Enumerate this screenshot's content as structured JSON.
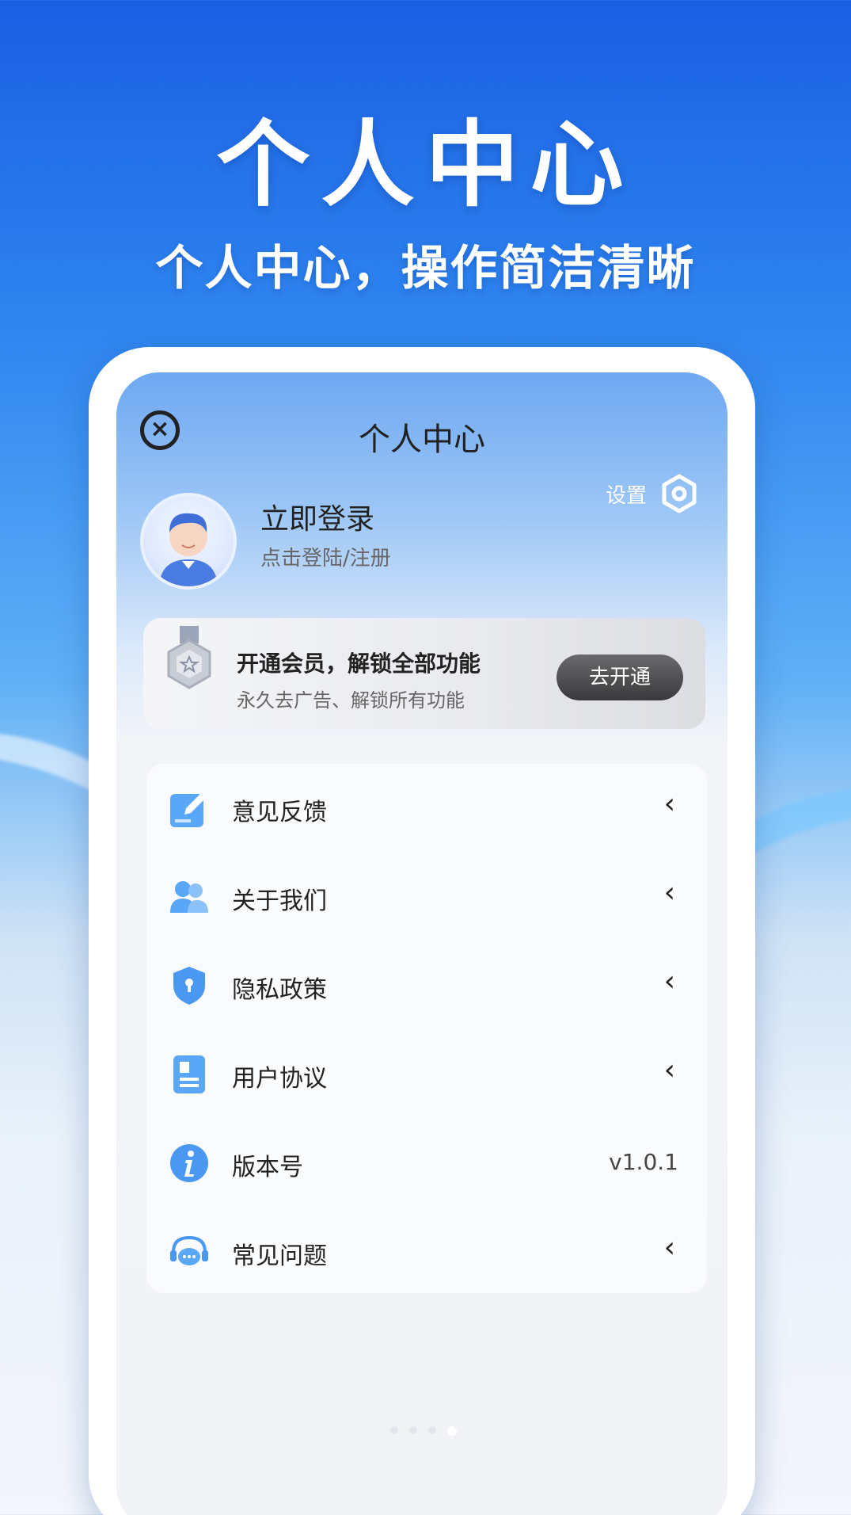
{
  "banner": {
    "headline": "个人中心",
    "subline": "个人中心，操作简洁清晰"
  },
  "header": {
    "title": "个人中心",
    "close_icon": "close-circle-icon",
    "settings_label": "设置",
    "settings_icon": "hexagon-gear-icon"
  },
  "profile": {
    "login_title": "立即登录",
    "login_sub": "点击登陆/注册"
  },
  "vip": {
    "title": "开通会员，解锁全部功能",
    "subtitle": "永久去广告、解锁所有功能",
    "button": "去开通"
  },
  "menu": [
    {
      "label": "意见反馈",
      "icon": "feedback-edit-icon",
      "arrow": "‹"
    },
    {
      "label": "关于我们",
      "icon": "users-icon",
      "arrow": "‹"
    },
    {
      "label": "隐私政策",
      "icon": "shield-icon",
      "arrow": "‹"
    },
    {
      "label": "用户协议",
      "icon": "document-icon",
      "arrow": "‹"
    },
    {
      "label": "版本号",
      "icon": "info-icon",
      "value": "v1.0.1"
    },
    {
      "label": "常见问题",
      "icon": "chat-support-icon",
      "arrow": "‹"
    }
  ],
  "colors": {
    "brand_blue": "#1a5fe3",
    "icon_blue": "#3a8ef5"
  }
}
